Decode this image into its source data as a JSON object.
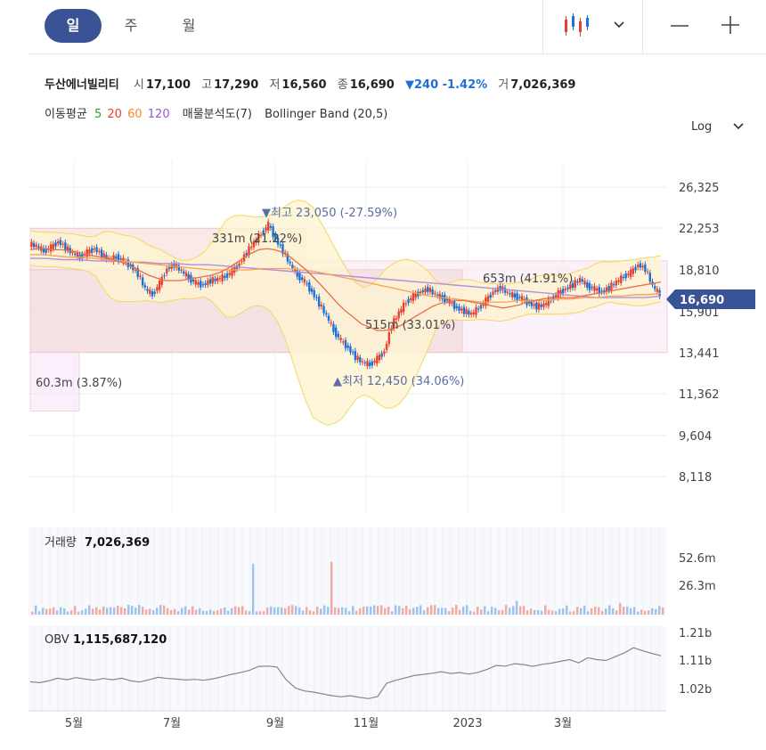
{
  "tabs": [
    {
      "label": "일",
      "active": true
    },
    {
      "label": "주",
      "active": false
    },
    {
      "label": "월",
      "active": false
    }
  ],
  "stock": {
    "name": "두산에너빌리티",
    "open_label": "시",
    "open": "17,100",
    "high_label": "고",
    "high": "17,290",
    "low_label": "저",
    "low": "16,560",
    "close_label": "종",
    "close": "16,690",
    "change": "▼240 -1.42%",
    "volume_label": "거",
    "volume": "7,026,369"
  },
  "indicators": {
    "ma_label": "이동평균",
    "ma_periods": [
      {
        "p": "5",
        "color": "#2ca02c"
      },
      {
        "p": "20",
        "color": "#e8422e"
      },
      {
        "p": "60",
        "color": "#f28b25"
      },
      {
        "p": "120",
        "color": "#9b59d6"
      }
    ],
    "vp_label": "매물분석도(7)",
    "bb_label": "Bollinger Band (20,5)"
  },
  "scale_button": "Log",
  "colors": {
    "up": "#e8422e",
    "down": "#1f6fd6",
    "accent": "#3a5397",
    "band": "#f6e07a",
    "vol_up": "#f4a8a2",
    "vol_down": "#9cc2ee",
    "obv": "#888888"
  },
  "chart_data": {
    "type": "line",
    "price_axis": {
      "scale": "log",
      "ticks": [
        "26,325",
        "22,253",
        "18,810",
        "15,901",
        "13,441",
        "11,362",
        "9,604",
        "8,118"
      ],
      "current": "16,690"
    },
    "x_labels": [
      "5월",
      "7월",
      "9월",
      "11월",
      "2023",
      "3월"
    ],
    "annotations": {
      "high": "▼최고 23,050 (-27.59%)",
      "low": "▲최저 12,450 (34.06%)",
      "vp": [
        "331m (21.22%)",
        "653m (41.91%)",
        "515m (33.01%)",
        "60.3m (3.87%)"
      ]
    },
    "price_series": [
      20900,
      20700,
      20300,
      20600,
      21100,
      20600,
      20100,
      19800,
      20200,
      20500,
      20000,
      19600,
      19800,
      19500,
      19100,
      18500,
      17400,
      17000,
      17800,
      18900,
      19200,
      18700,
      18200,
      17800,
      17700,
      18000,
      18100,
      18300,
      18700,
      19300,
      20200,
      21000,
      21800,
      22600,
      21300,
      20300,
      19200,
      18400,
      17900,
      17200,
      16400,
      15600,
      14700,
      14100,
      13700,
      13200,
      12900,
      12800,
      13100,
      13500,
      15000,
      15800,
      16500,
      16900,
      17200,
      17400,
      17000,
      16800,
      16500,
      16100,
      15900,
      15700,
      16100,
      16600,
      17200,
      17500,
      17100,
      16900,
      16700,
      16400,
      16200,
      16300,
      16700,
      17100,
      17400,
      17700,
      18100,
      17600,
      17400,
      17200,
      17500,
      17900,
      18300,
      18600,
      19200,
      18900,
      17600,
      17000
    ],
    "ma20_series": [
      20400,
      20500,
      20500,
      20400,
      20400,
      20300,
      20200,
      20000,
      19900,
      19800,
      19700,
      19500,
      19300,
      19000,
      18700,
      18400,
      18200,
      18000,
      18000,
      18000,
      18100,
      18200,
      18300,
      18400,
      18600,
      18900,
      19300,
      19700,
      20100,
      20400,
      20500,
      20400,
      20200,
      19800,
      19300,
      18800,
      18200,
      17600,
      17000,
      16400,
      15900,
      15500,
      15100,
      14900,
      14700,
      14700,
      14800,
      15000,
      15300,
      15600,
      15900,
      16200,
      16400,
      16500,
      16600,
      16600,
      16500,
      16400,
      16300,
      16200,
      16100,
      16200,
      16300,
      16500,
      16600,
      16700,
      16800,
      16800,
      16800,
      16800,
      16900,
      17000,
      17100,
      17200,
      17300,
      17400,
      17500,
      17600,
      17700,
      17800,
      17900
    ],
    "ma60_series": [
      20000,
      20000,
      19900,
      19800,
      19800,
      19700,
      19600,
      19500,
      19400,
      19300,
      19200,
      19100,
      19000,
      18900,
      18800,
      18800,
      18800,
      18800,
      18900,
      18900,
      18900,
      18800,
      18700,
      18500,
      18300,
      18100,
      17900,
      17700,
      17500,
      17300,
      17100,
      16900,
      16800,
      16700,
      16600,
      16500,
      16500,
      16500,
      16600,
      16600,
      16600,
      16700,
      16700,
      16800,
      16800,
      16900,
      16900,
      17000,
      17000,
      17100
    ],
    "ma120_series": [
      19700,
      19700,
      19600,
      19600,
      19500,
      19500,
      19400,
      19400,
      19300,
      19300,
      19200,
      19200,
      19100,
      19000,
      18900,
      18800,
      18700,
      18600,
      18500,
      18400,
      18300,
      18200,
      18100,
      18000,
      17900,
      17800,
      17700,
      17600,
      17500,
      17400,
      17300,
      17200,
      17100,
      17000,
      16900,
      16800,
      16800,
      16800,
      16800,
      16900
    ],
    "volume": {
      "label": "거래량",
      "value": "7,026,369",
      "ticks": [
        "52.6m",
        "26.3m"
      ]
    },
    "obv": {
      "label": "OBV",
      "value": "1,115,687,120",
      "ticks": [
        "1.21b",
        "1.11b",
        "1.02b"
      ],
      "series": [
        1.043,
        1.04,
        1.046,
        1.055,
        1.05,
        1.057,
        1.052,
        1.048,
        1.054,
        1.05,
        1.055,
        1.046,
        1.042,
        1.05,
        1.058,
        1.054,
        1.052,
        1.049,
        1.051,
        1.048,
        1.053,
        1.06,
        1.068,
        1.074,
        1.082,
        1.095,
        1.096,
        1.093,
        1.05,
        1.022,
        1.012,
        1.008,
        1.002,
        0.996,
        0.992,
        0.996,
        0.99,
        0.986,
        0.993,
        1.038,
        1.048,
        1.056,
        1.064,
        1.068,
        1.072,
        1.077,
        1.071,
        1.074,
        1.069,
        1.075,
        1.085,
        1.098,
        1.096,
        1.104,
        1.101,
        1.095,
        1.102,
        1.106,
        1.112,
        1.118,
        1.107,
        1.124,
        1.118,
        1.115,
        1.128,
        1.141,
        1.158,
        1.148,
        1.139,
        1.131
      ]
    }
  }
}
